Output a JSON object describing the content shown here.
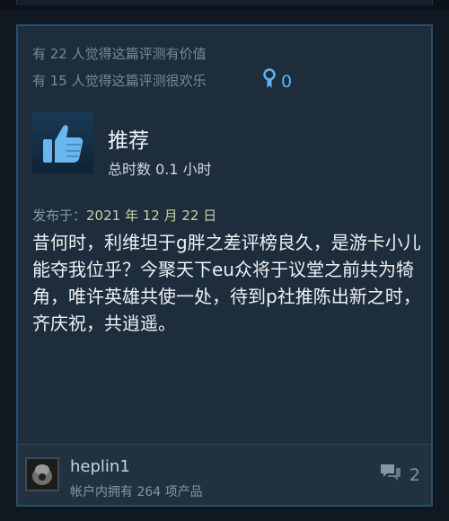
{
  "review": {
    "helpful_text": "有 22 人觉得这篇评测有价值",
    "funny_text": "有 15 人觉得这篇评测很欢乐",
    "award_count": "0",
    "recommendation": "推荐",
    "hours": "总时数 0.1 小时",
    "posted_label": "发布于：",
    "posted_date": "2021 年 12 月 22 日",
    "body": "昔何时，利维坦于g胖之差评榜良久，是游卡小儿能夺我位乎？今聚天下eu众将于议堂之前共为犄角，唯许英雄共使一处，待到p社推陈出新之时，齐庆祝，共逍遥。"
  },
  "author": {
    "username": "heplin1",
    "products": "帐户内拥有 264 项产品",
    "comment_count": "2"
  },
  "colors": {
    "accent": "#5eb4f0",
    "card_bg": "#1d2d3c",
    "page_bg": "#101822"
  }
}
